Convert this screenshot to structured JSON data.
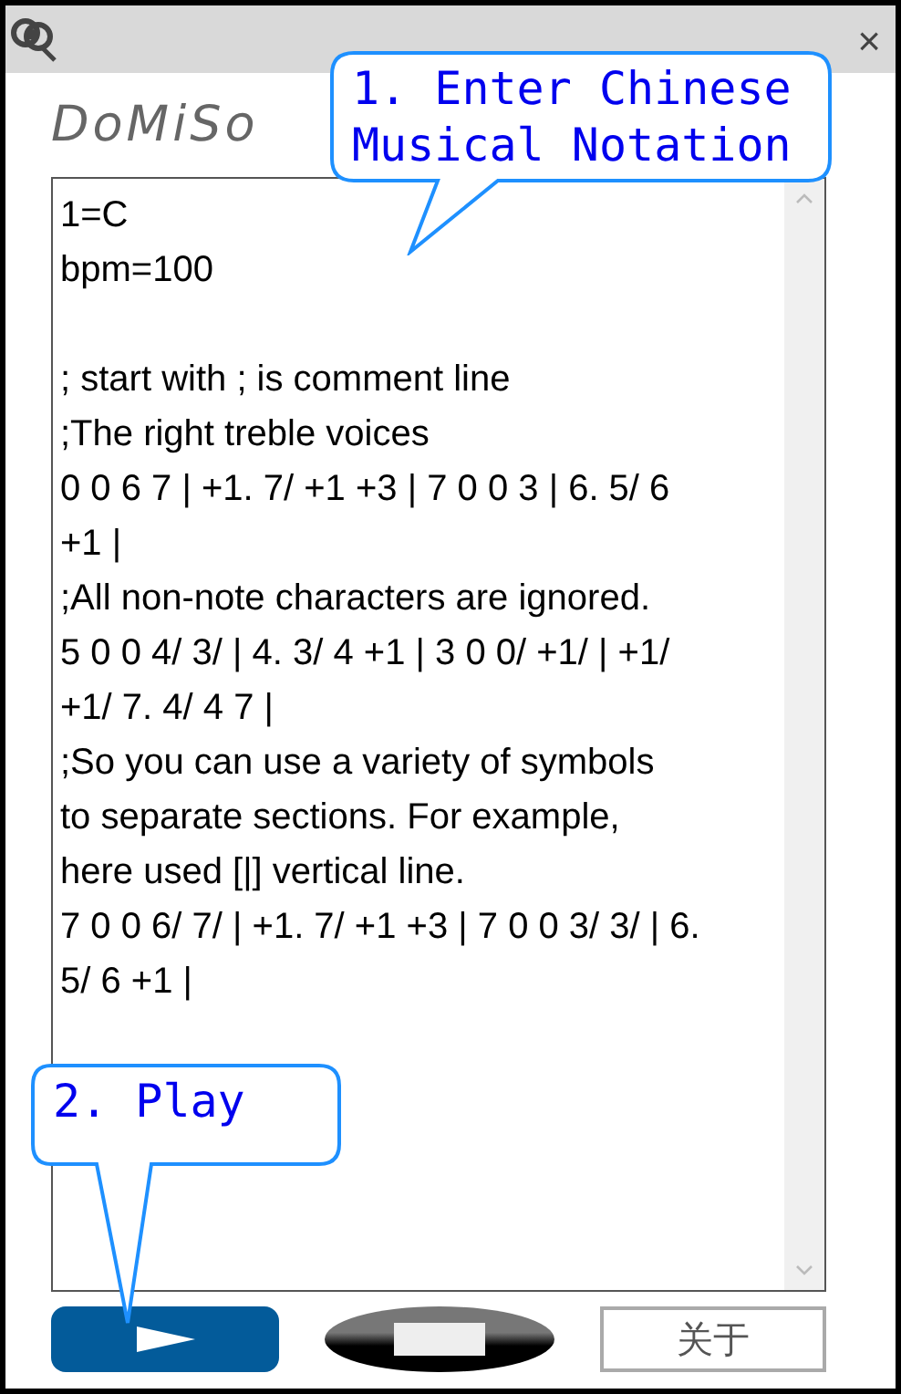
{
  "window": {
    "close": "×"
  },
  "logo": "DoMiSo",
  "editor": {
    "paragraphs": [
      [
        "1=C",
        "bpm=100"
      ],
      [
        "; start with ; is comment line",
        ";The right treble voices",
        "0 0 6 7 | +1. 7/ +1 +3 | 7 0 0 3 | 6. 5/ 6",
        "+1 |",
        ";All non-note characters are ignored.",
        "5 0 0 4/ 3/ | 4. 3/ 4 +1 | 3 0 0/ +1/ | +1/",
        "+1/ 7. 4/ 4 7 |",
        ";So you can use a variety of symbols",
        "to separate sections. For example,",
        "here used [|] vertical line.",
        "7 0 0 6/ 7/ | +1. 7/ +1 +3 | 7 0 0 3/ 3/ | 6.",
        "5/ 6 +1 |"
      ]
    ]
  },
  "buttons": [
    {
      "kind": "play"
    },
    {
      "kind": "stop"
    },
    {
      "kind": "text",
      "label": "关于"
    }
  ],
  "callouts": [
    {
      "text": "1. Enter Chinese\nMusical Notation"
    },
    {
      "text": "2. Play"
    }
  ]
}
